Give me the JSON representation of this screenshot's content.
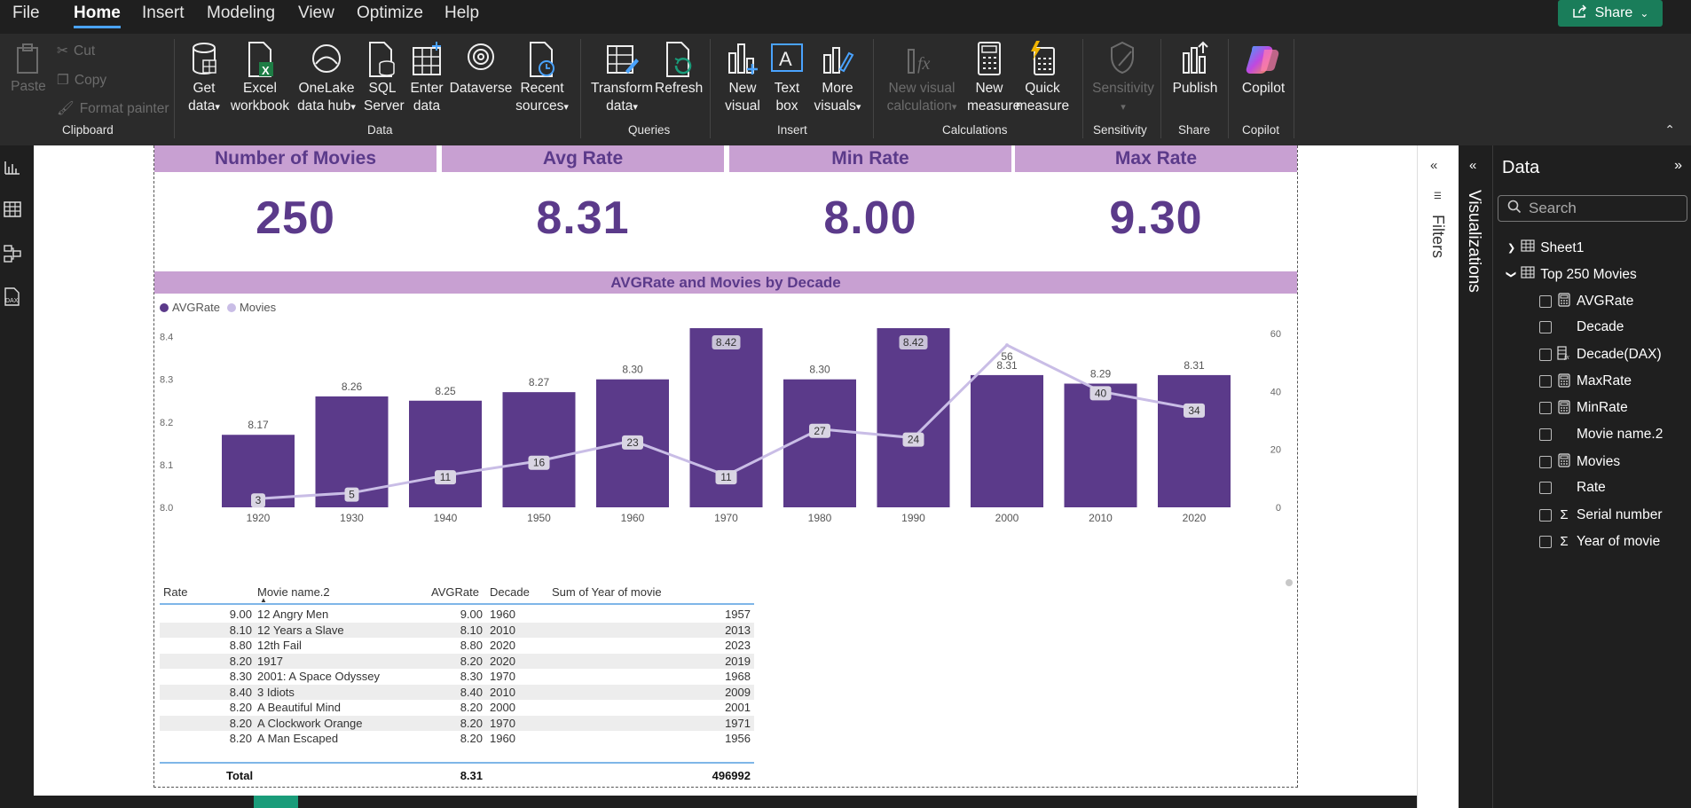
{
  "menu": [
    "File",
    "Home",
    "Insert",
    "Modeling",
    "View",
    "Optimize",
    "Help"
  ],
  "share_label": "Share",
  "ribbon": {
    "clipboard": {
      "paste": "Paste",
      "cut": "Cut",
      "copy": "Copy",
      "format_painter": "Format painter",
      "label": "Clipboard"
    },
    "data": {
      "get_data": [
        "Get",
        "data"
      ],
      "excel": [
        "Excel",
        "workbook"
      ],
      "onelake": [
        "OneLake",
        "data hub"
      ],
      "sql": [
        "SQL",
        "Server"
      ],
      "enter": [
        "Enter",
        "data"
      ],
      "dataverse": "Dataverse",
      "recent": [
        "Recent",
        "sources"
      ],
      "label": "Data"
    },
    "queries": {
      "transform": [
        "Transform",
        "data"
      ],
      "refresh": "Refresh",
      "label": "Queries"
    },
    "insert": {
      "new_visual": [
        "New",
        "visual"
      ],
      "text_box": [
        "Text",
        "box"
      ],
      "more_visuals": [
        "More",
        "visuals"
      ],
      "label": "Insert"
    },
    "calculations": {
      "new_visual_calc": [
        "New visual",
        "calculation"
      ],
      "new_measure": [
        "New",
        "measure"
      ],
      "quick_measure": [
        "Quick",
        "measure"
      ],
      "label": "Calculations"
    },
    "sensitivity": {
      "btn": "Sensitivity",
      "label": "Sensitivity"
    },
    "share": {
      "publish": "Publish",
      "label": "Share"
    },
    "copilot": {
      "btn": "Copilot",
      "label": "Copilot"
    }
  },
  "cards": [
    {
      "title": "Number of Movies",
      "value": "250"
    },
    {
      "title": "Avg Rate",
      "value": "8.31"
    },
    {
      "title": "Min Rate",
      "value": "8.00"
    },
    {
      "title": "Max Rate",
      "value": "9.30"
    }
  ],
  "chart_title": "AVGRate and Movies by Decade",
  "legend": [
    "AVGRate",
    "Movies"
  ],
  "chart_data": {
    "type": "bar",
    "categories": [
      "1920",
      "1930",
      "1940",
      "1950",
      "1960",
      "1970",
      "1980",
      "1990",
      "2000",
      "2010",
      "2020"
    ],
    "series": [
      {
        "name": "AVGRate",
        "type": "bar",
        "values": [
          8.17,
          8.26,
          8.25,
          8.27,
          8.3,
          8.42,
          8.3,
          8.42,
          8.31,
          8.29,
          8.31
        ],
        "labels": [
          "8.17",
          "8.26",
          "8.25",
          "8.27",
          "8.30",
          "8.42",
          "8.30",
          "8.42",
          "8.31",
          "8.29",
          "8.31"
        ]
      },
      {
        "name": "Movies",
        "type": "line",
        "values": [
          3,
          5,
          11,
          16,
          23,
          11,
          27,
          24,
          56,
          40,
          34
        ]
      }
    ],
    "y_left": {
      "ylim": [
        8.0,
        8.42
      ],
      "ticks": [
        "8.0",
        "8.1",
        "8.2",
        "8.3",
        "8.4"
      ]
    },
    "y_right": {
      "ylim": [
        0,
        60
      ],
      "ticks": [
        "0",
        "20",
        "40",
        "60"
      ]
    },
    "colors": {
      "bar": "#5b3a8a",
      "line": "#c9bde6"
    }
  },
  "table": {
    "columns": [
      "Rate",
      "Movie name.2",
      "AVGRate",
      "Decade",
      "Sum of Year of movie"
    ],
    "rows": [
      [
        "9.00",
        "12 Angry Men",
        "9.00",
        "1960",
        "1957"
      ],
      [
        "8.10",
        "12 Years a Slave",
        "8.10",
        "2010",
        "2013"
      ],
      [
        "8.80",
        "12th Fail",
        "8.80",
        "2020",
        "2023"
      ],
      [
        "8.20",
        "1917",
        "8.20",
        "2020",
        "2019"
      ],
      [
        "8.30",
        "2001: A Space Odyssey",
        "8.30",
        "1970",
        "1968"
      ],
      [
        "8.40",
        "3 Idiots",
        "8.40",
        "2010",
        "2009"
      ],
      [
        "8.20",
        "A Beautiful Mind",
        "8.20",
        "2000",
        "2001"
      ],
      [
        "8.20",
        "A Clockwork Orange",
        "8.20",
        "1970",
        "1971"
      ],
      [
        "8.20",
        "A Man Escaped",
        "8.20",
        "1960",
        "1956"
      ]
    ],
    "total": {
      "label": "Total",
      "avg": "8.31",
      "sum": "496992"
    }
  },
  "filters_label": "Filters",
  "viz_label": "Visualizations",
  "data_pane": {
    "title": "Data",
    "search_placeholder": "Search",
    "tables": [
      "Sheet1",
      "Top 250 Movies"
    ],
    "fields": [
      {
        "name": "AVGRate",
        "icon": "calculator-icon"
      },
      {
        "name": "Decade",
        "icon": ""
      },
      {
        "name": "Decade(DAX)",
        "icon": "calc-column-icon"
      },
      {
        "name": "MaxRate",
        "icon": "calculator-icon"
      },
      {
        "name": "MinRate",
        "icon": "calculator-icon"
      },
      {
        "name": "Movie name.2",
        "icon": ""
      },
      {
        "name": "Movies",
        "icon": "calculator-icon"
      },
      {
        "name": "Rate",
        "icon": ""
      },
      {
        "name": "Serial number",
        "icon": "sigma-icon"
      },
      {
        "name": "Year of movie",
        "icon": "sigma-icon"
      }
    ]
  }
}
